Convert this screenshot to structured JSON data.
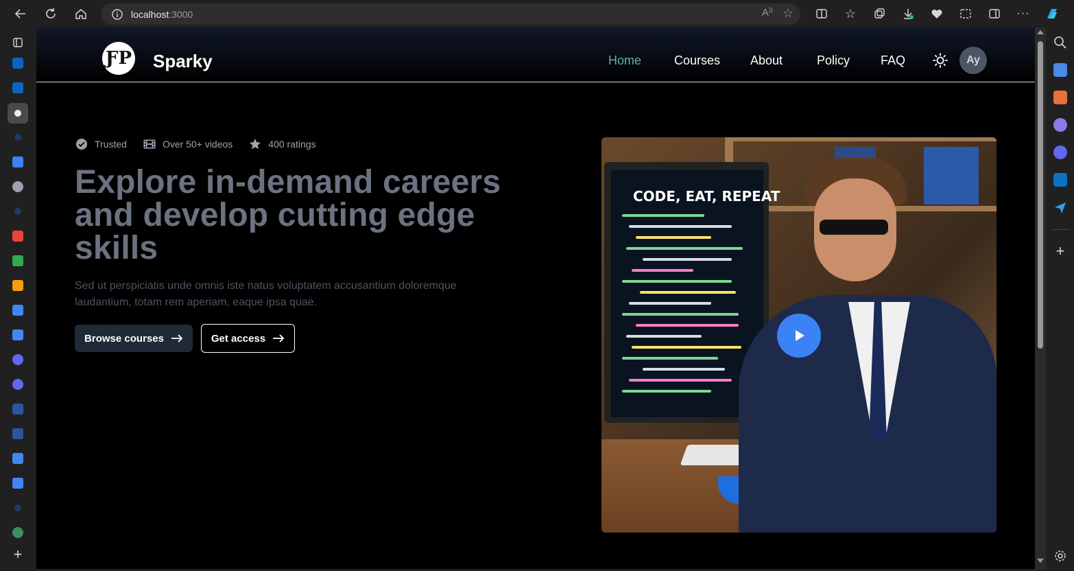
{
  "browser": {
    "url_host": "localhost",
    "url_port": ":3000"
  },
  "site": {
    "brand": "Sparky",
    "nav": [
      "Home",
      "Courses",
      "About",
      "Policy",
      "FAQ"
    ],
    "active_nav": "Home",
    "avatar_initials": "Ay"
  },
  "hero": {
    "badges": [
      {
        "icon": "check-circle-icon",
        "label": "Trusted"
      },
      {
        "icon": "film-icon",
        "label": "Over 50+ videos"
      },
      {
        "icon": "star-icon",
        "label": "400 ratings"
      }
    ],
    "headline": "Explore in-demand careers and develop cutting edge skills",
    "subtitle": "Sed ut perspiciatis unde omnis iste natus voluptatem accusantium doloremque laudantium, totam rem aperiam, eaque ipsa quae.",
    "primary_button": "Browse courses",
    "secondary_button": "Get access",
    "image_caption": "CODE, EAT, REPEAT"
  },
  "colors": {
    "active_nav": "#5fb3a6",
    "play_button": "#3b82f6",
    "primary_button_bg": "#1f2937"
  }
}
